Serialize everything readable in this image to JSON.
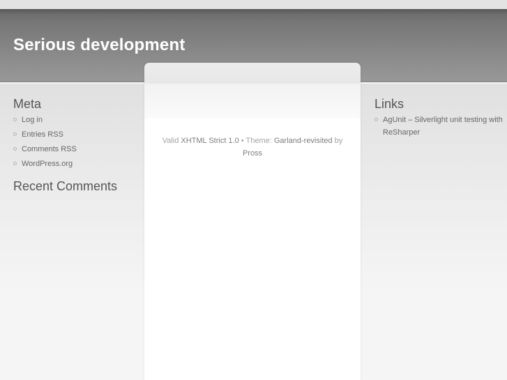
{
  "site": {
    "title": "Serious development"
  },
  "sidebar_left": {
    "sections": [
      {
        "title": "Meta",
        "items": [
          {
            "label": "Log in"
          },
          {
            "label": "Entries RSS"
          },
          {
            "label": "Comments RSS"
          },
          {
            "label": "WordPress.org"
          }
        ]
      },
      {
        "title": "Recent Comments",
        "items": []
      }
    ]
  },
  "sidebar_right": {
    "sections": [
      {
        "title": "Links",
        "items": [
          {
            "label": "AgUnit – Silverlight unit testing with ReSharper"
          }
        ]
      }
    ]
  },
  "footer": {
    "parts": [
      {
        "text": "Valid "
      },
      {
        "text": "XHTML Strict 1.0"
      },
      {
        "text": " • Theme: "
      },
      {
        "text": "Garland-revisited"
      },
      {
        "text": " by "
      },
      {
        "text": "Pross"
      }
    ]
  },
  "icons": {
    "list_bullet": "hollow-circle-bullet"
  },
  "colors": {
    "header_gradient_top": "#585858",
    "header_gradient_bottom": "#989898",
    "header_border": "#8d8d8d",
    "top_strip": "#e3e3e3",
    "page_bg_top": "#e0e0e0",
    "page_bg_bottom": "#f5f5f5",
    "column_band": "#e9e9e9",
    "title_text": "#ffffff",
    "heading_text": "#555555",
    "item_text": "#666666",
    "footer_text": "#a3a3a3",
    "footer_link": "#7d7d7d"
  }
}
